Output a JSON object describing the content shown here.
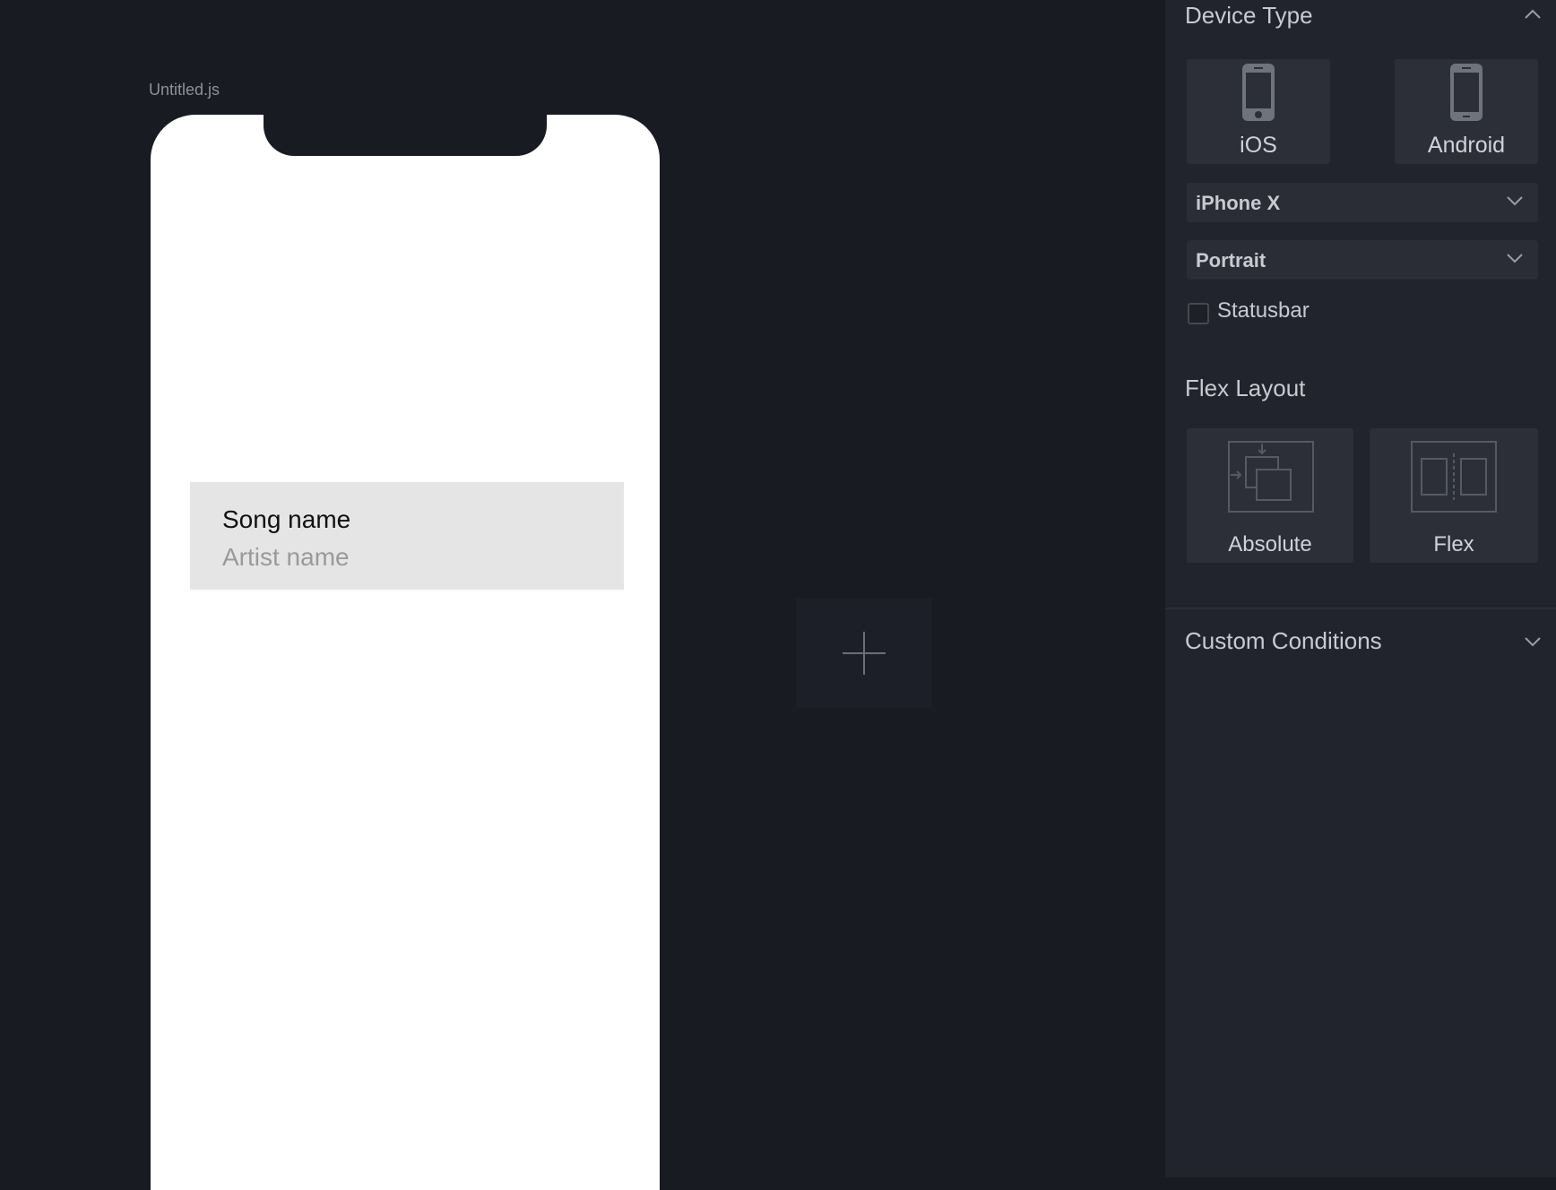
{
  "canvas": {
    "file_name": "Untitled.js",
    "list_item": {
      "title": "Song name",
      "subtitle": "Artist name"
    },
    "add_icon": "plus-icon"
  },
  "panel": {
    "device_type": {
      "title": "Device Type",
      "toggle_icon": "chevron-up-icon",
      "options": [
        {
          "label": "iOS",
          "icon": "phone-icon",
          "selected": true
        },
        {
          "label": "Android",
          "icon": "phone-icon",
          "selected": false
        }
      ],
      "device_select": "iPhone X",
      "orientation_select": "Portrait",
      "statusbar": {
        "label": "Statusbar",
        "checked": false
      }
    },
    "flex_layout": {
      "title": "Flex Layout",
      "options": [
        {
          "label": "Absolute",
          "icon": "absolute-layout-icon"
        },
        {
          "label": "Flex",
          "icon": "flex-layout-icon"
        }
      ]
    },
    "custom_conditions": {
      "title": "Custom Conditions",
      "toggle_icon": "chevron-down-icon"
    }
  },
  "colors": {
    "background": "#181b22",
    "panel": "#21242c",
    "card": "#2c2f38",
    "text": "#c7cad1"
  }
}
